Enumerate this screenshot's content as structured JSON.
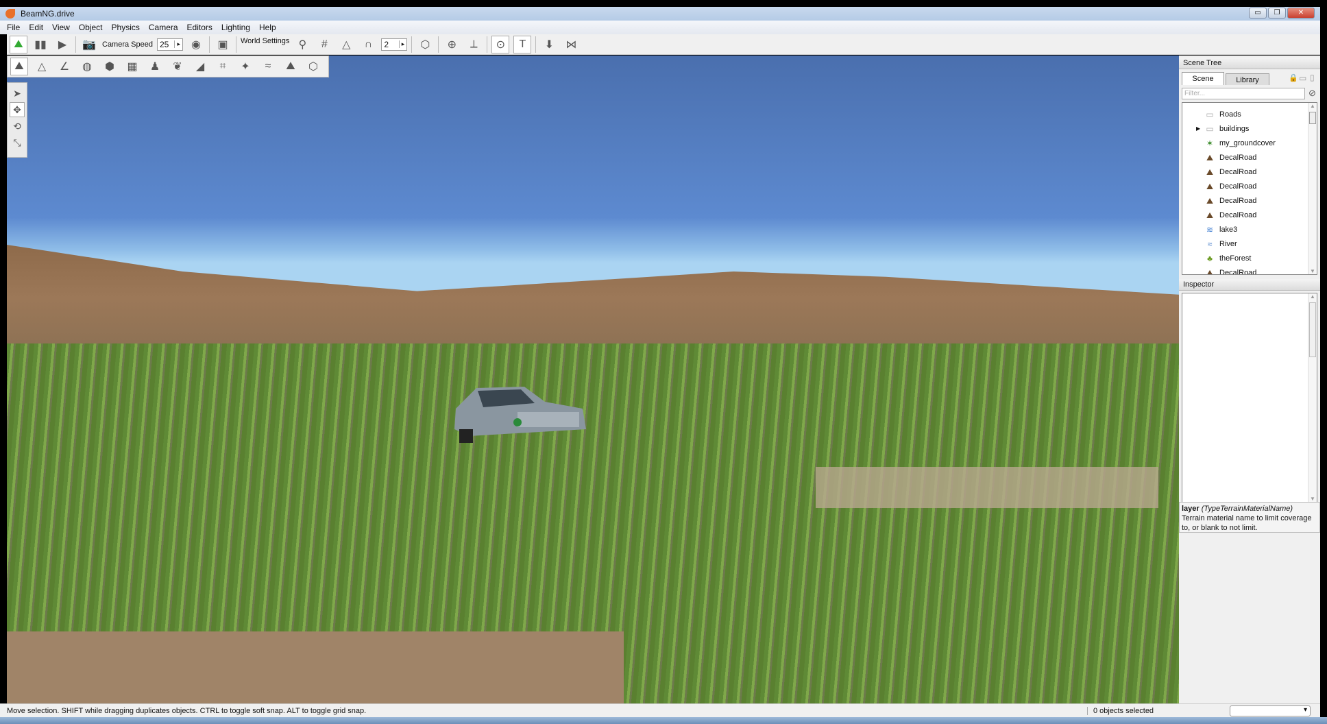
{
  "window": {
    "title": "BeamNG.drive",
    "minimize": "▭",
    "restore": "❐",
    "close": "✕"
  },
  "menu": [
    "File",
    "Edit",
    "View",
    "Object",
    "Physics",
    "Camera",
    "Editors",
    "Lighting",
    "Help"
  ],
  "toolbar": {
    "camera_speed_label": "Camera Speed",
    "camera_speed_value": "25",
    "world_settings_label": "World Settings",
    "snap_value": "2",
    "spin_arrow": "▸"
  },
  "scene_tree": {
    "title": "Scene Tree",
    "tabs": [
      "Scene",
      "Library"
    ],
    "filter_placeholder": "Filter...",
    "items": [
      {
        "label": "Roads",
        "icon": "folder-icon",
        "glyph": "▭"
      },
      {
        "label": "buildings",
        "icon": "folder-icon",
        "glyph": "▭",
        "expandable": "▶"
      },
      {
        "label": "my_groundcover",
        "icon": "grass-icon",
        "glyph": "✶"
      },
      {
        "label": "DecalRoad",
        "icon": "road-icon",
        "glyph": "⛰"
      },
      {
        "label": "DecalRoad",
        "icon": "road-icon",
        "glyph": "⛰"
      },
      {
        "label": "DecalRoad",
        "icon": "road-icon",
        "glyph": "⛰"
      },
      {
        "label": "DecalRoad",
        "icon": "road-icon",
        "glyph": "⛰"
      },
      {
        "label": "DecalRoad",
        "icon": "road-icon",
        "glyph": "⛰"
      },
      {
        "label": "lake3",
        "icon": "water-icon",
        "glyph": "≋"
      },
      {
        "label": "River",
        "icon": "river-icon",
        "glyph": "≈"
      },
      {
        "label": "theForest",
        "icon": "forest-icon",
        "glyph": "♣"
      },
      {
        "label": "DecalRoad",
        "icon": "road-icon",
        "glyph": "⛰"
      }
    ]
  },
  "inspector": {
    "title": "Inspector",
    "field_name": "layer",
    "field_type": "(TypeTerrainMaterialName)",
    "field_desc": "Terrain material name to limit coverage to, or blank to not limit."
  },
  "status": {
    "hint": "Move selection.  SHIFT while dragging duplicates objects.  CTRL to toggle soft snap.  ALT to toggle grid snap.",
    "selection": "0 objects selected",
    "dropdown_arrow": "▾"
  }
}
